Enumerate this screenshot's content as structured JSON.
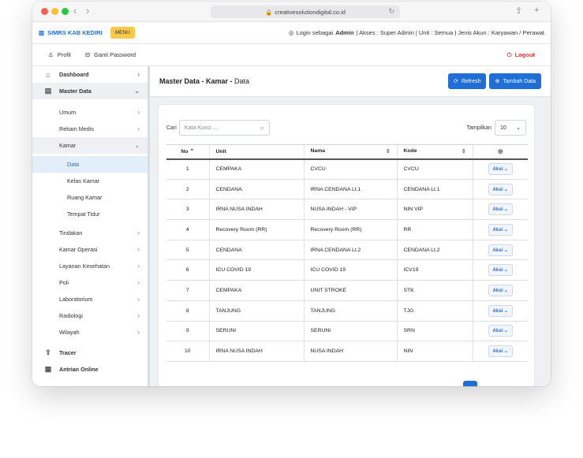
{
  "browser": {
    "url": "creativesolutiondigital.co.id"
  },
  "header": {
    "brand": "SIMRS KAB KEDIRI",
    "menu_label": "MENU",
    "login_prefix": "Login sebagai",
    "login_user": "Admin",
    "login_rest": "| Akses : Super Admin | Unit : Semua | Jenis Akun : Karyawan / Perawat"
  },
  "userbar": {
    "profil": "Profil",
    "ganti_password": "Ganti Password",
    "logout": "Logout"
  },
  "sidebar": {
    "dashboard": "Dashboard",
    "master_data": "Master Data",
    "umum": "Umum",
    "rekam_medis": "Rekam Medis",
    "kamar": "Kamar",
    "data": "Data",
    "kelas_kamar": "Kelas Kamar",
    "ruang_kamar": "Ruang Kamar",
    "tempat_tidur": "Tempat Tidur",
    "tindakan": "Tindakan",
    "kamar_operasi": "Kamar Operasi",
    "layanan_kesehatan": "Layanan Kesehatan",
    "poli": "Poli",
    "laboratorium": "Laboratorium",
    "radiologi": "Radiologi",
    "wilayah": "Wilayah",
    "tracer": "Tracer",
    "antrian_online": "Antrian Online"
  },
  "main": {
    "title_bold": "Master Data - Kamar -",
    "title_rest": "Data",
    "refresh": "Refresh",
    "tambah": "Tambah Data",
    "cari_label": "Cari",
    "search_placeholder": "Kata Kunci ...",
    "tampilkan_label": "Tampilkan",
    "tampilkan_value": "10"
  },
  "table": {
    "headers": {
      "no": "No",
      "unit": "Unit",
      "nama": "Nama",
      "kode": "Kode"
    },
    "aksi_label": "Aksi",
    "rows": [
      {
        "no": "1",
        "unit": "CEMPAKA",
        "nama": "CVCU",
        "kode": "CVCU"
      },
      {
        "no": "2",
        "unit": "CENDANA",
        "nama": "IRNA CENDANA Lt.1",
        "kode": "CENDANA Lt.1"
      },
      {
        "no": "3",
        "unit": "IRNA NUSA INDAH",
        "nama": "NUSA INDAH - VIP",
        "kode": "NIN VIP"
      },
      {
        "no": "4",
        "unit": "Recovery Room (RR)",
        "nama": "Recovery Room (RR)",
        "kode": "RR"
      },
      {
        "no": "5",
        "unit": "CENDANA",
        "nama": "IRNA CENDANA Lt.2",
        "kode": "CENDANA Lt.2"
      },
      {
        "no": "6",
        "unit": "ICU COVID 19",
        "nama": "ICU COVID 19",
        "kode": "ICV19"
      },
      {
        "no": "7",
        "unit": "CEMPAKA",
        "nama": "UNIT STROKE",
        "kode": "STK"
      },
      {
        "no": "8",
        "unit": "TANJUNG",
        "nama": "TANJUNG",
        "kode": "TJG"
      },
      {
        "no": "9",
        "unit": "SERUNI",
        "nama": "SERUNI",
        "kode": "SRN"
      },
      {
        "no": "10",
        "unit": "IRNA NUSA INDAH",
        "nama": "NUSA INDAH",
        "kode": "NIN"
      }
    ]
  }
}
